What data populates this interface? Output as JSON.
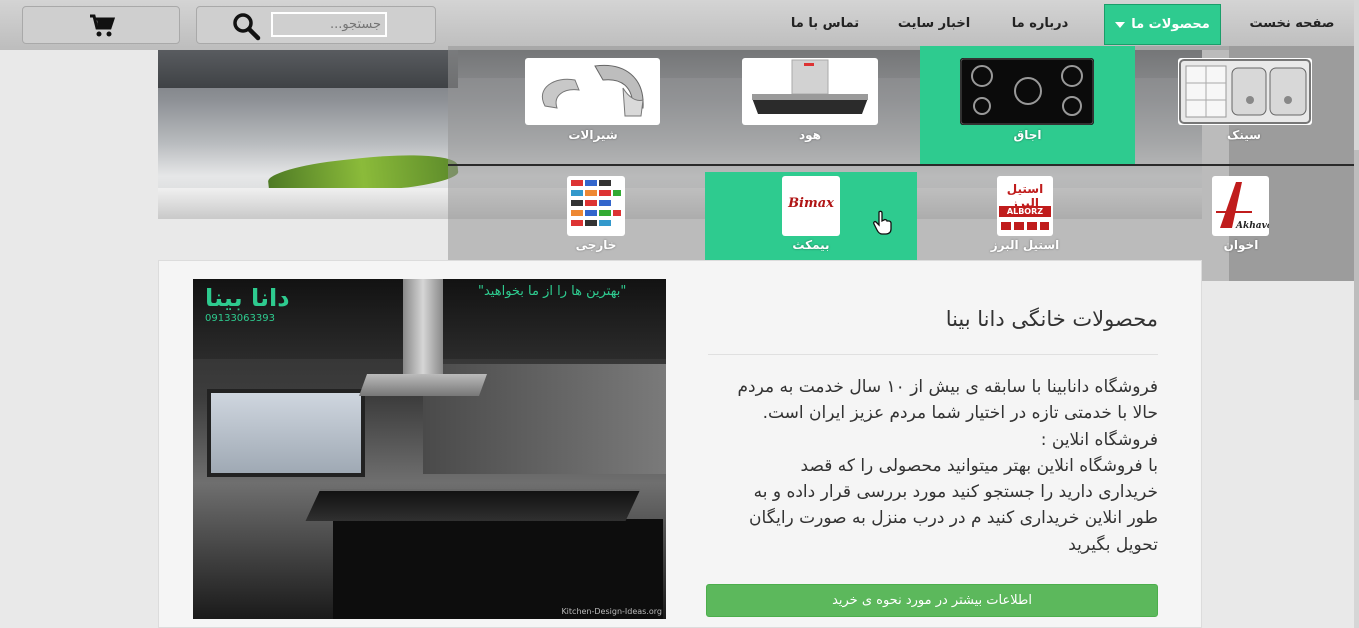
{
  "nav": {
    "home": "صفحه نخست",
    "products": "محصولات ما",
    "about": "درباره ما",
    "news": "اخبار سایت",
    "contact": "تماس با ما",
    "search_placeholder": "جستجو..."
  },
  "categories": [
    {
      "label": "سینک",
      "icon": "sink-icon"
    },
    {
      "label": "اجاق",
      "icon": "stove-icon"
    },
    {
      "label": "هود",
      "icon": "hood-icon"
    },
    {
      "label": "شیرالات",
      "icon": "faucet-icon"
    }
  ],
  "brands": [
    {
      "label": "اخوان",
      "logo_text": "Akhavan"
    },
    {
      "label": "استیل البرز",
      "logo_text": "استیل البرز",
      "logo_sub": "ALBORZ"
    },
    {
      "label": "بیمکث",
      "logo_text": "Bimax"
    },
    {
      "label": "خارجی",
      "logo_text": ""
    }
  ],
  "hero_image": {
    "brand_title": "دانا بینا",
    "brand_phone": "09133063393",
    "slogan": "\"بهترین ها را از ما بخواهید\"",
    "credit": "Kitchen-Design-Ideas.org"
  },
  "main": {
    "title": "محصولات خانگی دانا بینا",
    "description_lines": [
      "فروشگاه دانابینا با سابقه ی بیش از ۱۰ سال خدمت به مردم",
      "حالا با خدمتی تازه در اختیار شما مردم عزیز ایران است.",
      "فروشگاه انلاین :",
      "با فروشگاه انلاین بهتر میتوانید محصولی را که قصد",
      "خریداری دارید را جستجو کنید مورد بررسی قرار داده و به",
      "طور انلاین خریداری کنید م در درب منزل به صورت رایگان",
      "تحویل بگیرید"
    ],
    "cta": "اطلاعات بیشتر در مورد نحوه ی خرید"
  },
  "colors": {
    "accent": "#2ecb8f",
    "cta": "#5cb85c"
  }
}
